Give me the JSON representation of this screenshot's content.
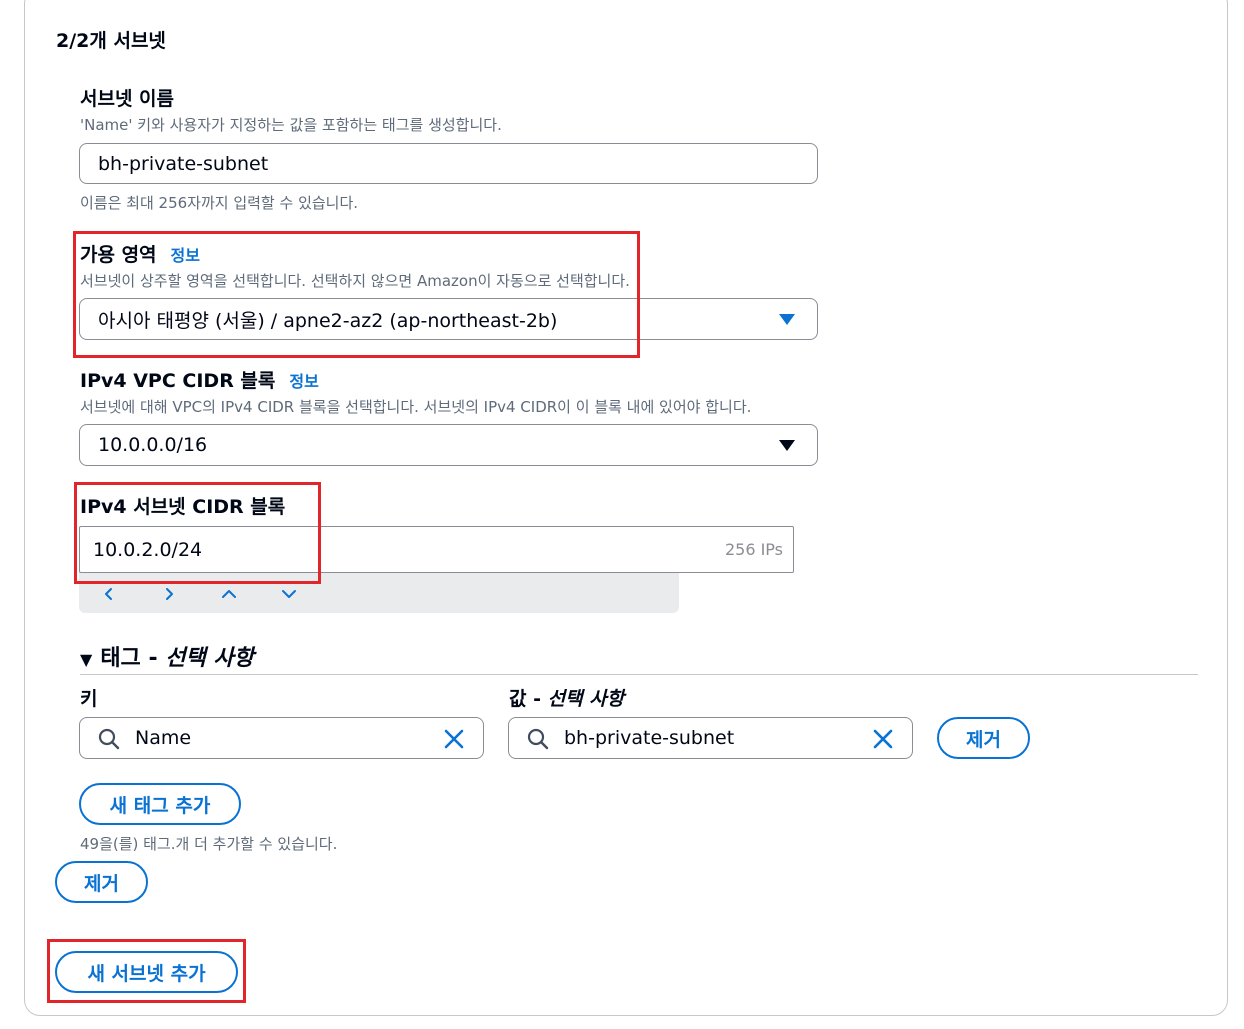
{
  "section": {
    "heading": "2/2개 서브넷"
  },
  "subnet_name": {
    "label": "서브넷 이름",
    "description": "'Name' 키와 사용자가 지정하는 값을 포함하는 태그를 생성합니다.",
    "value": "bh-private-subnet",
    "constraint": "이름은 최대 256자까지 입력할 수 있습니다."
  },
  "availability_zone": {
    "label": "가용 영역",
    "info": "정보",
    "description": "서브넷이 상주할 영역을 선택합니다. 선택하지 않으면 Amazon이 자동으로 선택합니다.",
    "selected": "아시아 태평양 (서울) / apne2-az2 (ap-northeast-2b)"
  },
  "vpc_cidr": {
    "label": "IPv4 VPC CIDR 블록",
    "info": "정보",
    "description": "서브넷에 대해 VPC의 IPv4 CIDR 블록을 선택합니다. 서브넷의 IPv4 CIDR이 이 블록 내에 있어야 합니다.",
    "selected": "10.0.0.0/16"
  },
  "subnet_cidr": {
    "label": "IPv4 서브넷 CIDR 블록",
    "value": "10.0.2.0/24",
    "ip_count": "256 IPs"
  },
  "tags": {
    "heading_main": "태그 - ",
    "heading_optional": "선택 사항",
    "key_label": "키",
    "value_label_main": "값 - ",
    "value_label_optional": "선택 사항",
    "key_value": "Name",
    "value_value": "bh-private-subnet",
    "remove_label": "제거",
    "add_tag_label": "새 태그 추가",
    "remaining_note": "49을(를) 태그.개 더 추가할 수 있습니다."
  },
  "subnet_actions": {
    "remove_label": "제거",
    "add_subnet_label": "새 서브넷 추가"
  },
  "colors": {
    "accent": "#0972d3",
    "highlight": "#e0252b",
    "text": "#000716",
    "muted": "#5f6b7a"
  }
}
